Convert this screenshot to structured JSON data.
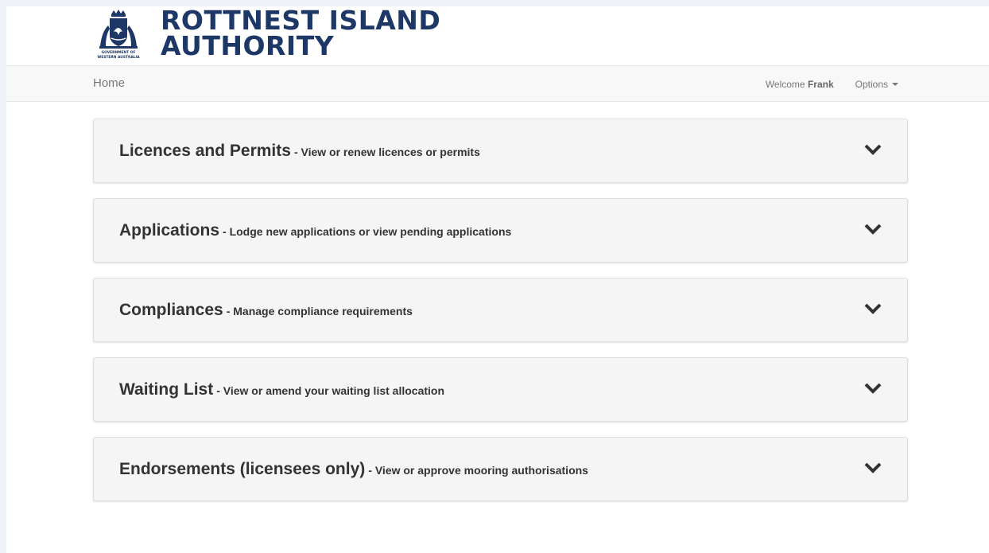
{
  "brand": {
    "line1": "ROTTNEST ISLAND",
    "line2": "AUTHORITY",
    "crest_text_line1": "GOVERNMENT OF",
    "crest_text_line2": "WESTERN AUSTRALIA"
  },
  "nav": {
    "home": "Home",
    "welcome_prefix": "Welcome",
    "user": "Frank",
    "options": "Options"
  },
  "panels": [
    {
      "title": "Licences and Permits",
      "subtitle": "- View or renew licences or permits"
    },
    {
      "title": "Applications",
      "subtitle": "- Lodge new applications or view pending applications"
    },
    {
      "title": "Compliances",
      "subtitle": "- Manage compliance requirements"
    },
    {
      "title": "Waiting List",
      "subtitle": "- View or amend your waiting list allocation"
    },
    {
      "title": "Endorsements (licensees only)",
      "subtitle": "- View or approve mooring authorisations"
    }
  ],
  "colors": {
    "brand": "#1d3767",
    "panel_bg": "#f5f5f5",
    "navbar_bg": "#f8f8f8"
  },
  "icons": {
    "panel_toggle": "chevron-down-icon",
    "logo": "wa-government-crest"
  }
}
